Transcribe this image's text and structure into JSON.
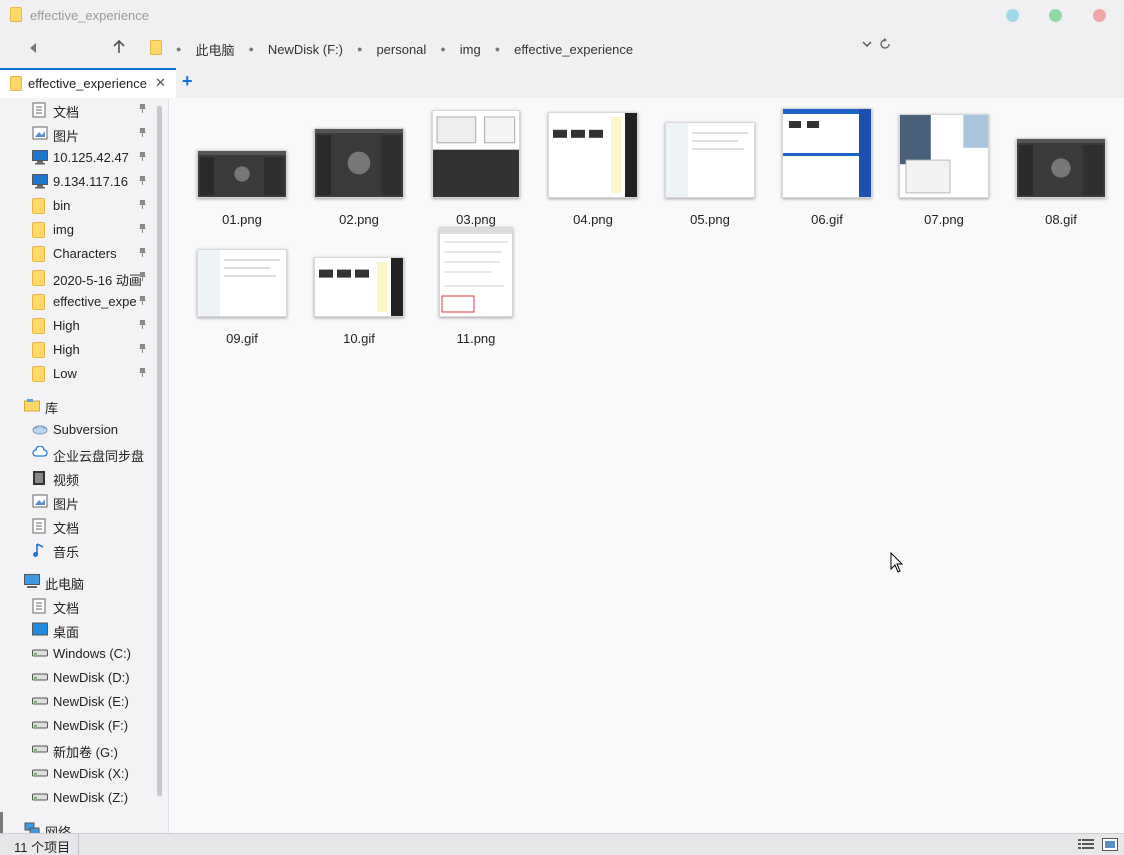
{
  "window": {
    "title": "effective_experience"
  },
  "breadcrumb": [
    "此电脑",
    "NewDisk (F:)",
    "personal",
    "img",
    "effective_experience"
  ],
  "tabs": [
    {
      "label": "effective_experience"
    }
  ],
  "sidebar": {
    "quick_access": [
      {
        "label": "文档",
        "icon": "document-icon",
        "pinned": true
      },
      {
        "label": "图片",
        "icon": "pictures-icon",
        "pinned": true
      },
      {
        "label": "10.125.42.47",
        "icon": "monitor-icon",
        "pinned": true
      },
      {
        "label": "9.134.117.16",
        "icon": "monitor-icon",
        "pinned": true
      },
      {
        "label": "bin",
        "icon": "folder-icon",
        "pinned": true
      },
      {
        "label": "img",
        "icon": "folder-icon",
        "pinned": true
      },
      {
        "label": "Characters",
        "icon": "folder-icon",
        "pinned": true
      },
      {
        "label": "2020-5-16 动画",
        "icon": "folder-icon",
        "pinned": true
      },
      {
        "label": "effective_expe",
        "icon": "folder-icon",
        "pinned": true
      },
      {
        "label": "High",
        "icon": "folder-icon",
        "pinned": true
      },
      {
        "label": "High",
        "icon": "folder-icon",
        "pinned": true
      },
      {
        "label": "Low",
        "icon": "folder-icon",
        "pinned": true
      }
    ],
    "library_label": "库",
    "library": [
      {
        "label": "Subversion",
        "icon": "subversion-icon"
      },
      {
        "label": "企业云盘同步盘",
        "icon": "cloud-icon"
      },
      {
        "label": "视频",
        "icon": "video-icon"
      },
      {
        "label": "图片",
        "icon": "pictures-icon"
      },
      {
        "label": "文档",
        "icon": "document-icon"
      },
      {
        "label": "音乐",
        "icon": "music-icon"
      }
    ],
    "computer_label": "此电脑",
    "computer": [
      {
        "label": "文档",
        "icon": "document-icon"
      },
      {
        "label": "桌面",
        "icon": "desktop-icon"
      },
      {
        "label": "Windows (C:)",
        "icon": "drive-icon"
      },
      {
        "label": "NewDisk (D:)",
        "icon": "drive-icon"
      },
      {
        "label": "NewDisk (E:)",
        "icon": "drive-icon"
      },
      {
        "label": "NewDisk (F:)",
        "icon": "drive-icon"
      },
      {
        "label": "新加卷 (G:)",
        "icon": "drive-icon"
      },
      {
        "label": "NewDisk (X:)",
        "icon": "drive-icon"
      },
      {
        "label": "NewDisk (Z:)",
        "icon": "drive-icon"
      }
    ],
    "network_label": "网络"
  },
  "files": [
    {
      "name": "01.png",
      "theme": "dark"
    },
    {
      "name": "02.png",
      "theme": "dark"
    },
    {
      "name": "03.png",
      "theme": "mixed"
    },
    {
      "name": "04.png",
      "theme": "light-dark"
    },
    {
      "name": "05.png",
      "theme": "light"
    },
    {
      "name": "06.gif",
      "theme": "blue"
    },
    {
      "name": "07.png",
      "theme": "photo"
    },
    {
      "name": "08.gif",
      "theme": "dark"
    },
    {
      "name": "09.gif",
      "theme": "light"
    },
    {
      "name": "10.gif",
      "theme": "light-dark"
    },
    {
      "name": "11.png",
      "theme": "dialog"
    }
  ],
  "status": {
    "count": "11 个项目"
  },
  "colors": {
    "accent": "#0c74d6",
    "folder": "#ffd86a"
  }
}
